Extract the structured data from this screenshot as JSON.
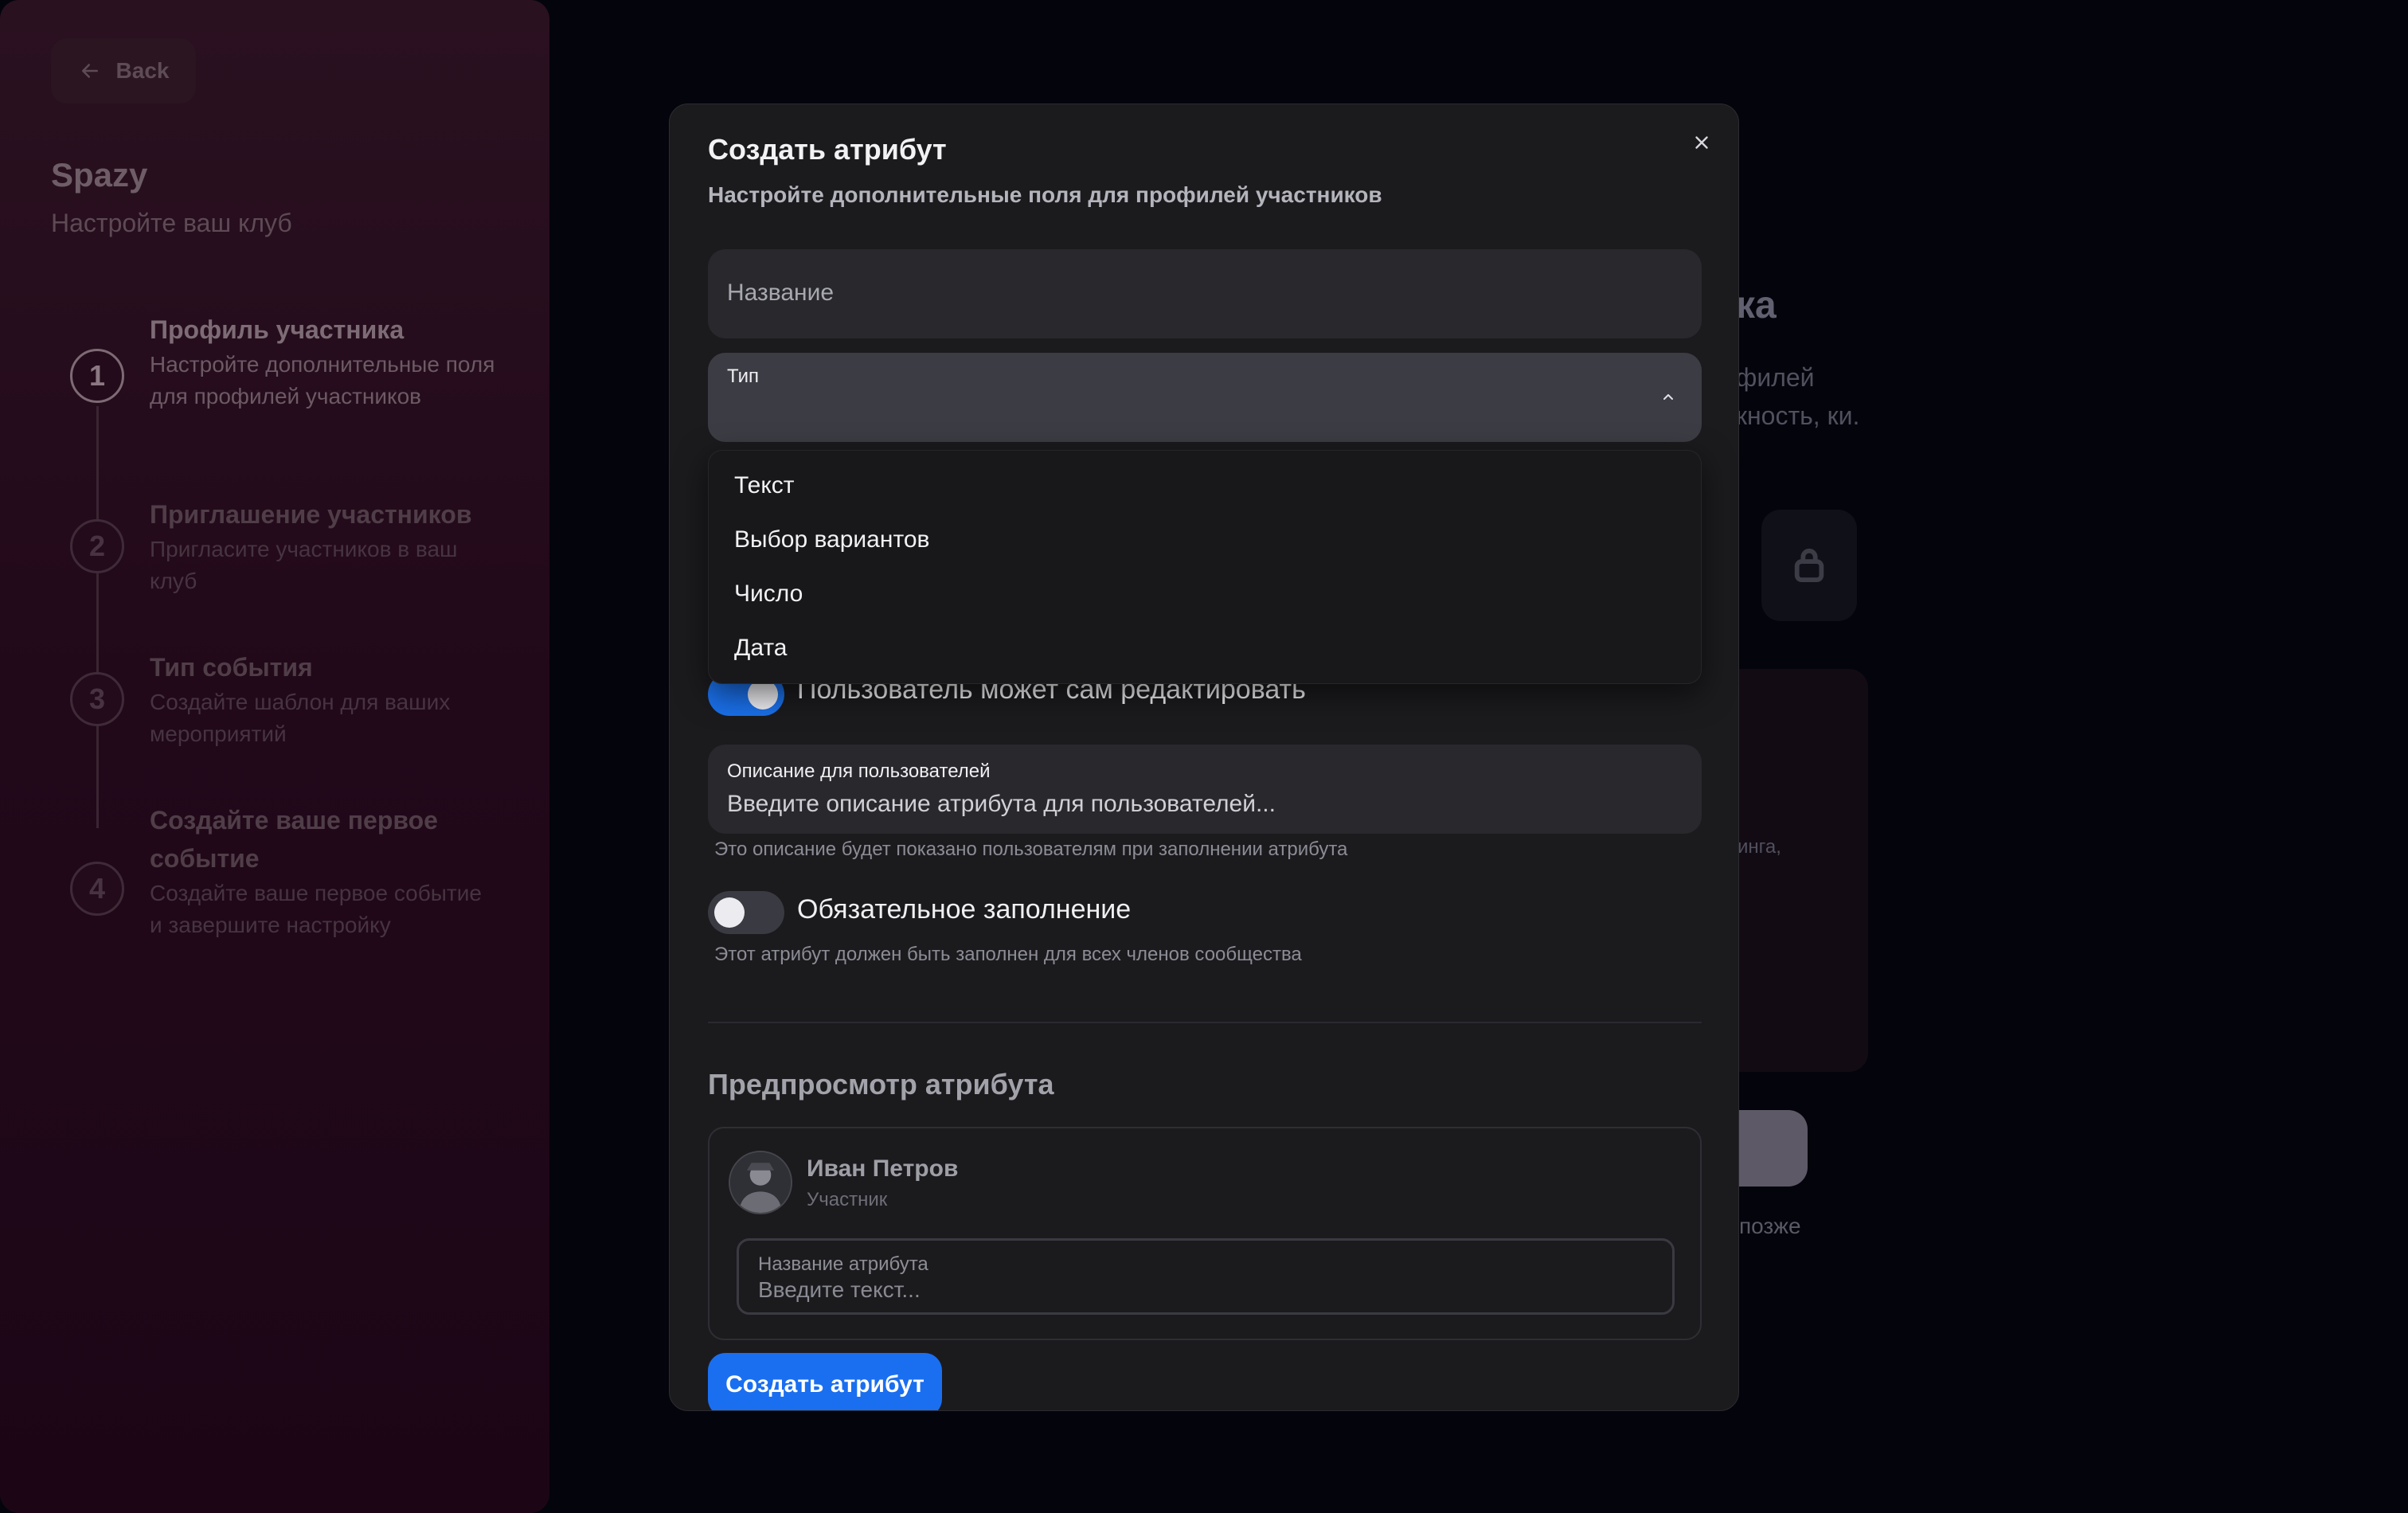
{
  "sidebar": {
    "back_label": "Back",
    "brand": "Spazy",
    "subtitle": "Настройте ваш клуб",
    "steps": [
      {
        "num": "1",
        "title": "Профиль участника",
        "desc": "Настройте дополнительные поля для профилей участников"
      },
      {
        "num": "2",
        "title": "Приглашение участников",
        "desc": "Пригласите участников в ваш клуб"
      },
      {
        "num": "3",
        "title": "Тип события",
        "desc": "Создайте шаблон для ваших мероприятий"
      },
      {
        "num": "4",
        "title": "Создайте ваше первое событие",
        "desc": "Создайте ваше первое событие и завершите настройку"
      }
    ]
  },
  "background": {
    "heading_fragment": "ка",
    "text_fragment": "филей кность, ки.",
    "card_text_fragment": "инга,",
    "later_fragment": "позже"
  },
  "modal": {
    "title": "Создать атрибут",
    "subtitle": "Настройте дополнительные поля для профилей участников",
    "name_placeholder": "Название",
    "type_label": "Тип",
    "type_options": [
      "Текст",
      "Выбор вариантов",
      "Число",
      "Дата"
    ],
    "edit_toggle_label": "Пользователь может сам редактировать",
    "edit_toggle_on": true,
    "desc_label": "Описание для пользователей",
    "desc_placeholder": "Введите описание атрибута для пользователей...",
    "desc_hint": "Это описание будет показано пользователям при заполнении атрибута",
    "required_toggle_label": "Обязательное заполнение",
    "required_toggle_on": false,
    "required_hint": "Этот атрибут должен быть заполнен для всех членов сообщества",
    "preview_title": "Предпросмотр атрибута",
    "preview_user_name": "Иван Петров",
    "preview_user_role": "Участник",
    "preview_field_label": "Название атрибута",
    "preview_field_placeholder": "Введите текст...",
    "submit_label": "Создать атрибут"
  },
  "colors": {
    "accent": "#1a6ff0",
    "modal_bg": "#1b1b1e",
    "sidebar_bg": "#22091a"
  }
}
